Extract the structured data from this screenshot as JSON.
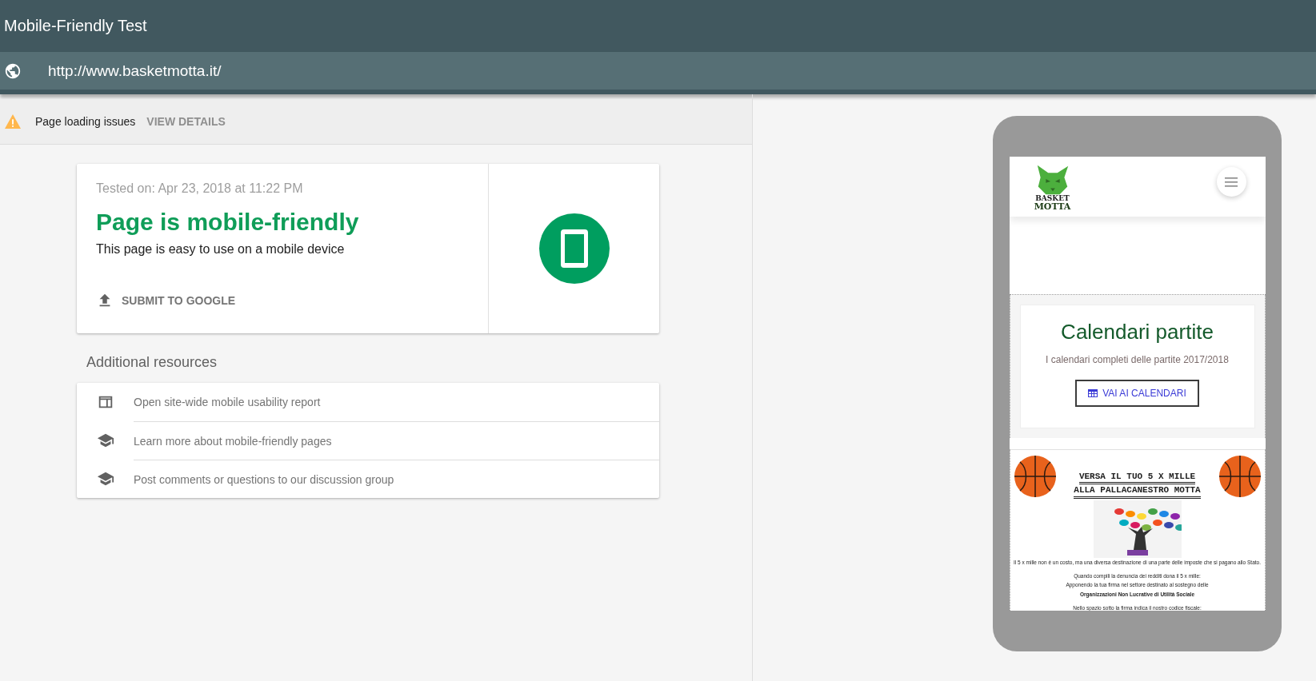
{
  "header": {
    "title": "Mobile-Friendly Test"
  },
  "url_bar": {
    "url": "http://www.basketmotta.it/"
  },
  "issues_bar": {
    "message": "Page loading issues",
    "action": "VIEW DETAILS"
  },
  "result_card": {
    "tested_on": "Tested on: Apr 23, 2018 at 11:22 PM",
    "verdict": "Page is mobile-friendly",
    "description": "This page is easy to use on a mobile device",
    "action": "SUBMIT TO GOOGLE"
  },
  "additional_resources": {
    "title": "Additional resources",
    "items": [
      {
        "kind": "report",
        "label": "Open site-wide mobile usability report"
      },
      {
        "kind": "learn",
        "label": "Learn more about mobile-friendly pages"
      },
      {
        "kind": "learn",
        "label": "Post comments or questions to our discussion group"
      }
    ]
  },
  "phone_preview": {
    "logo_lines": [
      "BASKET",
      "MOTTA"
    ],
    "hero": {
      "title": "Calendari partite",
      "subtitle": "I calendari completi delle partite 2017/2018",
      "button": "VAI AI CALENDARI"
    },
    "banner": {
      "heading_lines": [
        "VERSA IL TUO 5 X MILLE",
        "ALLA PALLACANESTRO MOTTA"
      ],
      "text_lines": [
        {
          "text": "Il 5 x mille non è un costo, ma una diversa destinazione di una parte delle imposte che si pagano allo Stato.",
          "bold": false,
          "gap": false
        },
        {
          "text": "Quando compili la denuncia dei redditi dona il 5 x mille:",
          "bold": false,
          "gap": true
        },
        {
          "text": "Apponendo la tua firma nel settore destinato al sostegno delle",
          "bold": false,
          "gap": false
        },
        {
          "text": "Organizzazioni Non Lucrative di Utilità Sociale",
          "bold": true,
          "gap": false
        },
        {
          "text": "Nello spazio sotto la firma indica il nostro codice fiscale:",
          "bold": false,
          "gap": true
        }
      ]
    }
  }
}
